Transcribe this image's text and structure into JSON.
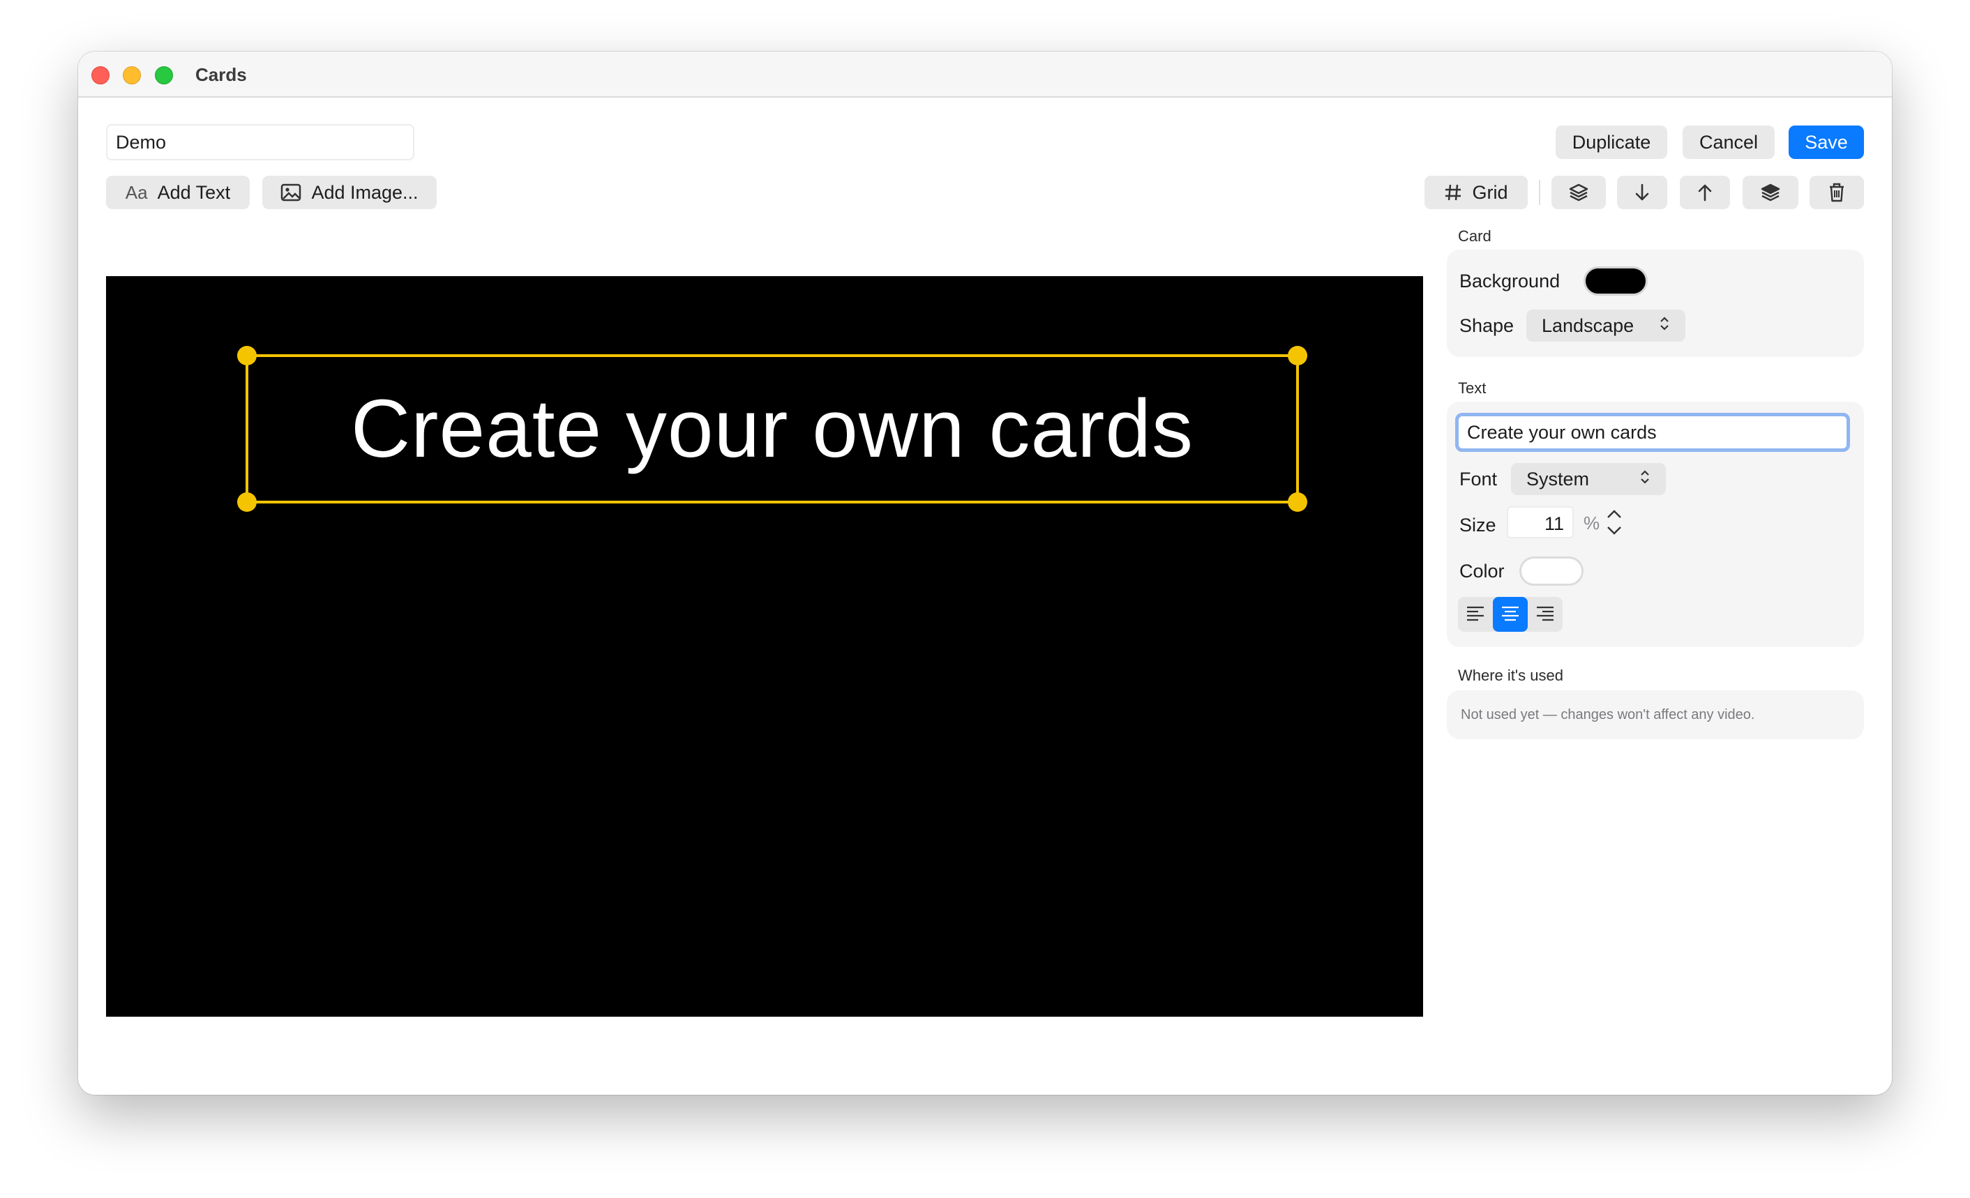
{
  "window": {
    "title": "Cards"
  },
  "toolbar": {
    "card_name": "Demo",
    "add_text_glyph": "Aa",
    "add_text_label": "Add Text",
    "add_image_label": "Add Image...",
    "grid_label": "Grid",
    "duplicate_label": "Duplicate",
    "cancel_label": "Cancel",
    "save_label": "Save",
    "icons": [
      "grid-icon",
      "bring-to-front-icon",
      "move-down-icon",
      "move-up-icon",
      "send-to-back-icon",
      "trash-icon"
    ]
  },
  "canvas": {
    "background": "#000000",
    "selected_text": "Create your own cards",
    "selection_color": "#f5c400",
    "text_color": "#ffffff"
  },
  "inspector": {
    "card": {
      "section_label": "Card",
      "background_label": "Background",
      "background_color": "#000000",
      "shape_label": "Shape",
      "shape_value": "Landscape"
    },
    "text": {
      "section_label": "Text",
      "content": "Create your own cards",
      "font_label": "Font",
      "font_value": "System",
      "size_label": "Size",
      "size_value": "11",
      "size_unit": "%",
      "color_label": "Color",
      "color_value": "#ffffff",
      "alignment_options": [
        "left",
        "center",
        "right"
      ],
      "alignment_selected": "center"
    },
    "usage": {
      "section_label": "Where it's used",
      "message": "Not used yet — changes won't affect any video."
    }
  },
  "colors": {
    "accent": "#0a7aff",
    "selection": "#f5c400"
  }
}
